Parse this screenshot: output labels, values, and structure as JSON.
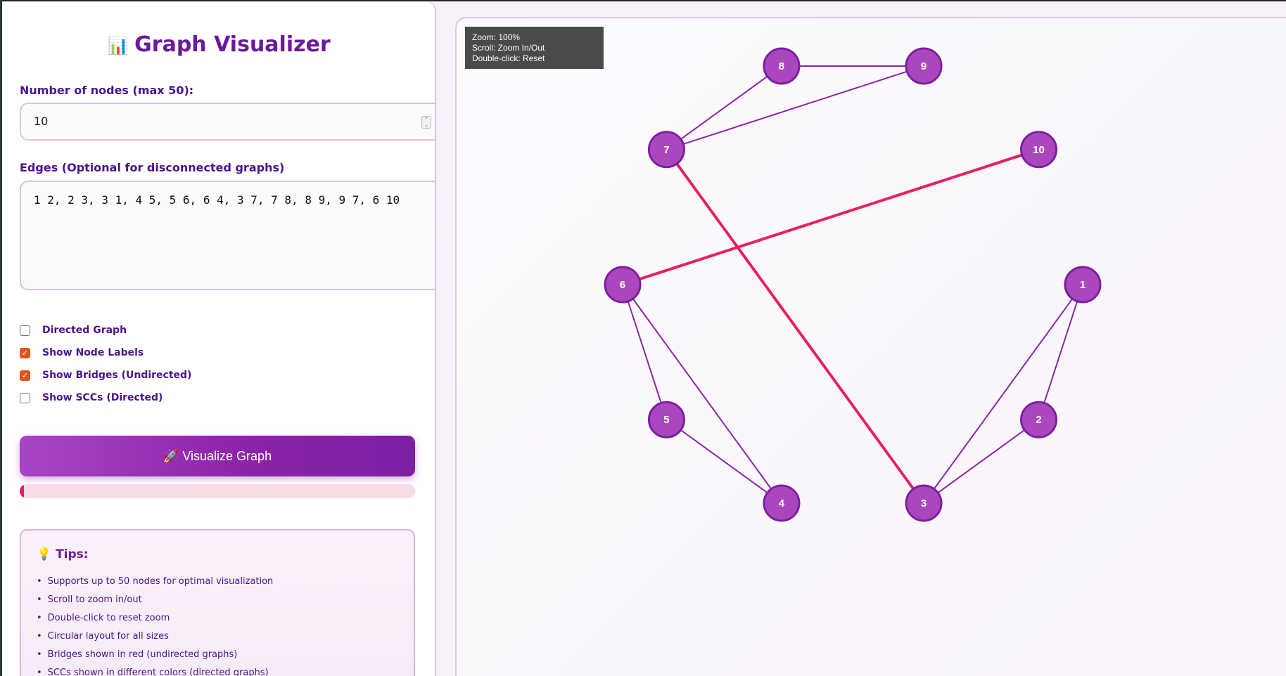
{
  "app": {
    "title": "Graph Visualizer",
    "title_icon": "bar-chart-icon"
  },
  "controls": {
    "nodes_label": "Number of nodes (max 50):",
    "nodes_value": "10",
    "edges_label": "Edges (Optional for disconnected graphs)",
    "edges_value": "1 2, 2 3, 3 1, 4 5, 5 6, 6 4, 3 7, 7 8, 8 9, 9 7, 6 10",
    "checkboxes": [
      {
        "label": "Directed Graph",
        "checked": false
      },
      {
        "label": "Show Node Labels",
        "checked": true
      },
      {
        "label": "Show Bridges (Undirected)",
        "checked": true
      },
      {
        "label": "Show SCCs (Directed)",
        "checked": false
      }
    ],
    "visualize_button": "🚀 Visualize Graph",
    "progress": 0.01
  },
  "tips": {
    "title": "💡 Tips:",
    "items": [
      "Supports up to 50 nodes for optimal visualization",
      "Scroll to zoom in/out",
      "Double-click to reset zoom",
      "Circular layout for all sizes",
      "Bridges shown in red (undirected graphs)",
      "SCCs shown in different colors (directed graphs)"
    ]
  },
  "canvas": {
    "zoom_text": "Zoom: 100%",
    "scroll_hint": "Scroll: Zoom In/Out",
    "reset_hint": "Double-click: Reset",
    "graph": {
      "nodes": [
        "1",
        "2",
        "3",
        "4",
        "5",
        "6",
        "7",
        "8",
        "9",
        "10"
      ],
      "edges": [
        {
          "from": "1",
          "to": "2",
          "bridge": false
        },
        {
          "from": "2",
          "to": "3",
          "bridge": false
        },
        {
          "from": "3",
          "to": "1",
          "bridge": false
        },
        {
          "from": "4",
          "to": "5",
          "bridge": false
        },
        {
          "from": "5",
          "to": "6",
          "bridge": false
        },
        {
          "from": "6",
          "to": "4",
          "bridge": false
        },
        {
          "from": "3",
          "to": "7",
          "bridge": true
        },
        {
          "from": "7",
          "to": "8",
          "bridge": false
        },
        {
          "from": "8",
          "to": "9",
          "bridge": false
        },
        {
          "from": "9",
          "to": "7",
          "bridge": false
        },
        {
          "from": "6",
          "to": "10",
          "bridge": true
        }
      ],
      "colors": {
        "node_fill": "#ab47bc",
        "node_stroke": "#7b1fa2",
        "edge": "#8e24aa",
        "bridge": "#e91e63"
      }
    }
  }
}
